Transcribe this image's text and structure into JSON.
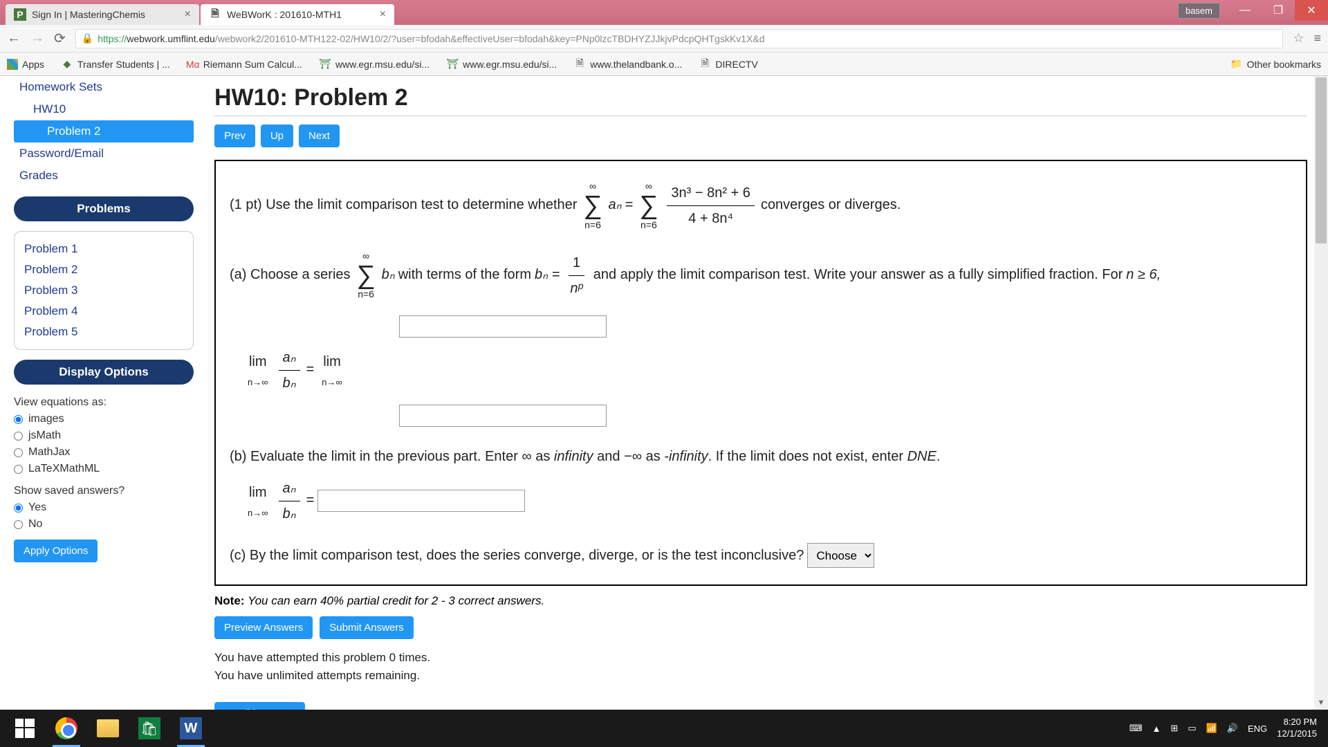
{
  "window": {
    "tabs": [
      {
        "title": "Sign In | MasteringChemis",
        "favicon": "P",
        "favcolor": "#4a7a3a"
      },
      {
        "title": "WeBWorK : 201610-MTH1",
        "favicon": "📄",
        "favcolor": "#888"
      }
    ],
    "user_badge": "basem"
  },
  "url": {
    "protocol": "https://",
    "domain": "webwork.umflint.edu",
    "path": "/webwork2/201610-MTH122-02/HW10/2/?user=bfodah&effectiveUser=bfodah&key=PNp0lzcTBDHYZJJkjvPdcpQHTgskKv1X&d"
  },
  "bookmarks": {
    "apps": "Apps",
    "items": [
      {
        "icon": "🟢",
        "label": "Transfer Students | ..."
      },
      {
        "icon": "Mα",
        "label": "Riemann Sum Calcul..."
      },
      {
        "icon": "🏛",
        "label": "www.egr.msu.edu/si..."
      },
      {
        "icon": "🏛",
        "label": "www.egr.msu.edu/si..."
      },
      {
        "icon": "📄",
        "label": "www.thelandbank.o..."
      },
      {
        "icon": "📄",
        "label": "DIRECTV"
      }
    ],
    "other": "Other bookmarks"
  },
  "sidebar": {
    "links": [
      {
        "label": "Homework Sets",
        "indent": 0
      },
      {
        "label": "HW10",
        "indent": 1
      },
      {
        "label": "Problem 2",
        "indent": 2,
        "active": true
      },
      {
        "label": "Password/Email",
        "indent": 0
      },
      {
        "label": "Grades",
        "indent": 0
      }
    ],
    "problems_header": "Problems",
    "problems": [
      "Problem 1",
      "Problem 2",
      "Problem 3",
      "Problem 4",
      "Problem 5"
    ],
    "display_header": "Display Options",
    "view_label": "View equations as:",
    "view_opts": [
      "images",
      "jsMath",
      "MathJax",
      "LaTeXMathML"
    ],
    "view_selected": "images",
    "saved_label": "Show saved answers?",
    "saved_opts": [
      "Yes",
      "No"
    ],
    "saved_selected": "Yes",
    "apply": "Apply Options"
  },
  "main": {
    "title": "HW10: Problem 2",
    "nav": {
      "prev": "Prev",
      "up": "Up",
      "next": "Next"
    },
    "q_intro": "(1 pt) Use the limit comparison test to determine whether",
    "sum_lower": "n=6",
    "sum_upper": "∞",
    "an": "aₙ",
    "frac_top": "3n³ − 8n² + 6",
    "frac_bot": "4 + 8n⁴",
    "q_tail": "converges or diverges.",
    "part_a1": "(a) Choose a series",
    "bn": "bₙ",
    "part_a2": "with terms of the form",
    "bn_eq": "bₙ =",
    "bfrac_top": "1",
    "bfrac_bot": "nᵖ",
    "part_a3": "and apply the limit comparison test. Write your answer as a fully simplified fraction. For",
    "cond": "n ≥ 6,",
    "lim_label": "lim",
    "lim_sub": "n→∞",
    "ratio_top": "aₙ",
    "ratio_bot": "bₙ",
    "eq": "=",
    "part_b": "(b) Evaluate the limit in the previous part. Enter ∞ as ",
    "infinity": "infinity",
    "and": " and −∞ as ",
    "neg_infinity": "-infinity",
    "dne_text": ". If the limit does not exist, enter ",
    "dne": "DNE",
    "period": ".",
    "part_c": "(c) By the limit comparison test, does the series converge, diverge, or is the test inconclusive?",
    "choose": "Choose",
    "note_label": "Note:",
    "note_text": "You can earn 40% partial credit for 2 - 3 correct answers.",
    "preview": "Preview Answers",
    "submit": "Submit Answers",
    "attempts1": "You have attempted this problem 0 times.",
    "attempts2": "You have unlimited attempts remaining.",
    "email": "Email instructor"
  },
  "taskbar": {
    "lang": "ENG",
    "time": "8:20 PM",
    "date": "12/1/2015"
  }
}
